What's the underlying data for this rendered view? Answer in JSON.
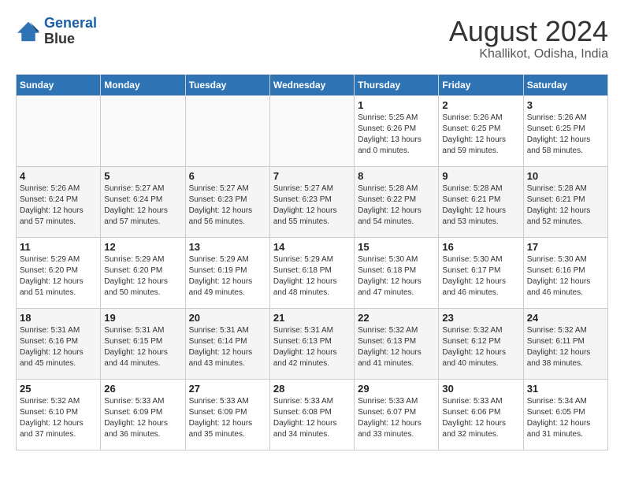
{
  "header": {
    "logo_line1": "General",
    "logo_line2": "Blue",
    "month_title": "August 2024",
    "location": "Khallikot, Odisha, India"
  },
  "weekdays": [
    "Sunday",
    "Monday",
    "Tuesday",
    "Wednesday",
    "Thursday",
    "Friday",
    "Saturday"
  ],
  "weeks": [
    [
      {
        "day": "",
        "sunrise": "",
        "sunset": "",
        "daylight": ""
      },
      {
        "day": "",
        "sunrise": "",
        "sunset": "",
        "daylight": ""
      },
      {
        "day": "",
        "sunrise": "",
        "sunset": "",
        "daylight": ""
      },
      {
        "day": "",
        "sunrise": "",
        "sunset": "",
        "daylight": ""
      },
      {
        "day": "1",
        "sunrise": "Sunrise: 5:25 AM",
        "sunset": "Sunset: 6:26 PM",
        "daylight": "Daylight: 13 hours and 0 minutes."
      },
      {
        "day": "2",
        "sunrise": "Sunrise: 5:26 AM",
        "sunset": "Sunset: 6:25 PM",
        "daylight": "Daylight: 12 hours and 59 minutes."
      },
      {
        "day": "3",
        "sunrise": "Sunrise: 5:26 AM",
        "sunset": "Sunset: 6:25 PM",
        "daylight": "Daylight: 12 hours and 58 minutes."
      }
    ],
    [
      {
        "day": "4",
        "sunrise": "Sunrise: 5:26 AM",
        "sunset": "Sunset: 6:24 PM",
        "daylight": "Daylight: 12 hours and 57 minutes."
      },
      {
        "day": "5",
        "sunrise": "Sunrise: 5:27 AM",
        "sunset": "Sunset: 6:24 PM",
        "daylight": "Daylight: 12 hours and 57 minutes."
      },
      {
        "day": "6",
        "sunrise": "Sunrise: 5:27 AM",
        "sunset": "Sunset: 6:23 PM",
        "daylight": "Daylight: 12 hours and 56 minutes."
      },
      {
        "day": "7",
        "sunrise": "Sunrise: 5:27 AM",
        "sunset": "Sunset: 6:23 PM",
        "daylight": "Daylight: 12 hours and 55 minutes."
      },
      {
        "day": "8",
        "sunrise": "Sunrise: 5:28 AM",
        "sunset": "Sunset: 6:22 PM",
        "daylight": "Daylight: 12 hours and 54 minutes."
      },
      {
        "day": "9",
        "sunrise": "Sunrise: 5:28 AM",
        "sunset": "Sunset: 6:21 PM",
        "daylight": "Daylight: 12 hours and 53 minutes."
      },
      {
        "day": "10",
        "sunrise": "Sunrise: 5:28 AM",
        "sunset": "Sunset: 6:21 PM",
        "daylight": "Daylight: 12 hours and 52 minutes."
      }
    ],
    [
      {
        "day": "11",
        "sunrise": "Sunrise: 5:29 AM",
        "sunset": "Sunset: 6:20 PM",
        "daylight": "Daylight: 12 hours and 51 minutes."
      },
      {
        "day": "12",
        "sunrise": "Sunrise: 5:29 AM",
        "sunset": "Sunset: 6:20 PM",
        "daylight": "Daylight: 12 hours and 50 minutes."
      },
      {
        "day": "13",
        "sunrise": "Sunrise: 5:29 AM",
        "sunset": "Sunset: 6:19 PM",
        "daylight": "Daylight: 12 hours and 49 minutes."
      },
      {
        "day": "14",
        "sunrise": "Sunrise: 5:29 AM",
        "sunset": "Sunset: 6:18 PM",
        "daylight": "Daylight: 12 hours and 48 minutes."
      },
      {
        "day": "15",
        "sunrise": "Sunrise: 5:30 AM",
        "sunset": "Sunset: 6:18 PM",
        "daylight": "Daylight: 12 hours and 47 minutes."
      },
      {
        "day": "16",
        "sunrise": "Sunrise: 5:30 AM",
        "sunset": "Sunset: 6:17 PM",
        "daylight": "Daylight: 12 hours and 46 minutes."
      },
      {
        "day": "17",
        "sunrise": "Sunrise: 5:30 AM",
        "sunset": "Sunset: 6:16 PM",
        "daylight": "Daylight: 12 hours and 46 minutes."
      }
    ],
    [
      {
        "day": "18",
        "sunrise": "Sunrise: 5:31 AM",
        "sunset": "Sunset: 6:16 PM",
        "daylight": "Daylight: 12 hours and 45 minutes."
      },
      {
        "day": "19",
        "sunrise": "Sunrise: 5:31 AM",
        "sunset": "Sunset: 6:15 PM",
        "daylight": "Daylight: 12 hours and 44 minutes."
      },
      {
        "day": "20",
        "sunrise": "Sunrise: 5:31 AM",
        "sunset": "Sunset: 6:14 PM",
        "daylight": "Daylight: 12 hours and 43 minutes."
      },
      {
        "day": "21",
        "sunrise": "Sunrise: 5:31 AM",
        "sunset": "Sunset: 6:13 PM",
        "daylight": "Daylight: 12 hours and 42 minutes."
      },
      {
        "day": "22",
        "sunrise": "Sunrise: 5:32 AM",
        "sunset": "Sunset: 6:13 PM",
        "daylight": "Daylight: 12 hours and 41 minutes."
      },
      {
        "day": "23",
        "sunrise": "Sunrise: 5:32 AM",
        "sunset": "Sunset: 6:12 PM",
        "daylight": "Daylight: 12 hours and 40 minutes."
      },
      {
        "day": "24",
        "sunrise": "Sunrise: 5:32 AM",
        "sunset": "Sunset: 6:11 PM",
        "daylight": "Daylight: 12 hours and 38 minutes."
      }
    ],
    [
      {
        "day": "25",
        "sunrise": "Sunrise: 5:32 AM",
        "sunset": "Sunset: 6:10 PM",
        "daylight": "Daylight: 12 hours and 37 minutes."
      },
      {
        "day": "26",
        "sunrise": "Sunrise: 5:33 AM",
        "sunset": "Sunset: 6:09 PM",
        "daylight": "Daylight: 12 hours and 36 minutes."
      },
      {
        "day": "27",
        "sunrise": "Sunrise: 5:33 AM",
        "sunset": "Sunset: 6:09 PM",
        "daylight": "Daylight: 12 hours and 35 minutes."
      },
      {
        "day": "28",
        "sunrise": "Sunrise: 5:33 AM",
        "sunset": "Sunset: 6:08 PM",
        "daylight": "Daylight: 12 hours and 34 minutes."
      },
      {
        "day": "29",
        "sunrise": "Sunrise: 5:33 AM",
        "sunset": "Sunset: 6:07 PM",
        "daylight": "Daylight: 12 hours and 33 minutes."
      },
      {
        "day": "30",
        "sunrise": "Sunrise: 5:33 AM",
        "sunset": "Sunset: 6:06 PM",
        "daylight": "Daylight: 12 hours and 32 minutes."
      },
      {
        "day": "31",
        "sunrise": "Sunrise: 5:34 AM",
        "sunset": "Sunset: 6:05 PM",
        "daylight": "Daylight: 12 hours and 31 minutes."
      }
    ]
  ]
}
